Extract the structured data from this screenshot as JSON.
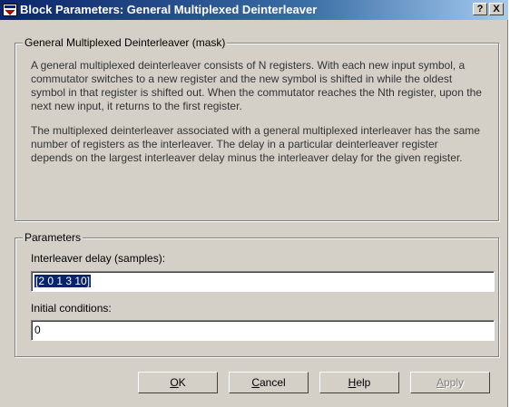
{
  "window": {
    "title": "Block Parameters: General Multiplexed Deinterleaver"
  },
  "titlebar": {
    "help": "?",
    "close": "X"
  },
  "mask": {
    "legend": "General Multiplexed Deinterleaver (mask)",
    "para1": "A general multiplexed deinterleaver consists of N registers.  With each new input symbol, a commutator switches to a new register and the new symbol is shifted in while the oldest symbol in that register is shifted out.  When the commutator reaches the Nth register, upon the next new input, it returns to the first register.",
    "para2": "The multiplexed deinterleaver associated with a general multiplexed interleaver has the same number of registers as the interleaver.  The delay in a particular deinterleaver register depends on the largest interleaver delay minus the interleaver delay for the given register."
  },
  "params": {
    "legend": "Parameters",
    "delay_label": "Interleaver delay (samples):",
    "delay_value": "[2 0 1 3 10]",
    "init_label": "Initial conditions:",
    "init_value": "0"
  },
  "buttons": {
    "ok_u": "O",
    "ok_rest": "K",
    "cancel_u": "C",
    "cancel_rest": "ancel",
    "help_u": "H",
    "help_rest": "elp",
    "apply_u": "A",
    "apply_rest": "pply"
  }
}
